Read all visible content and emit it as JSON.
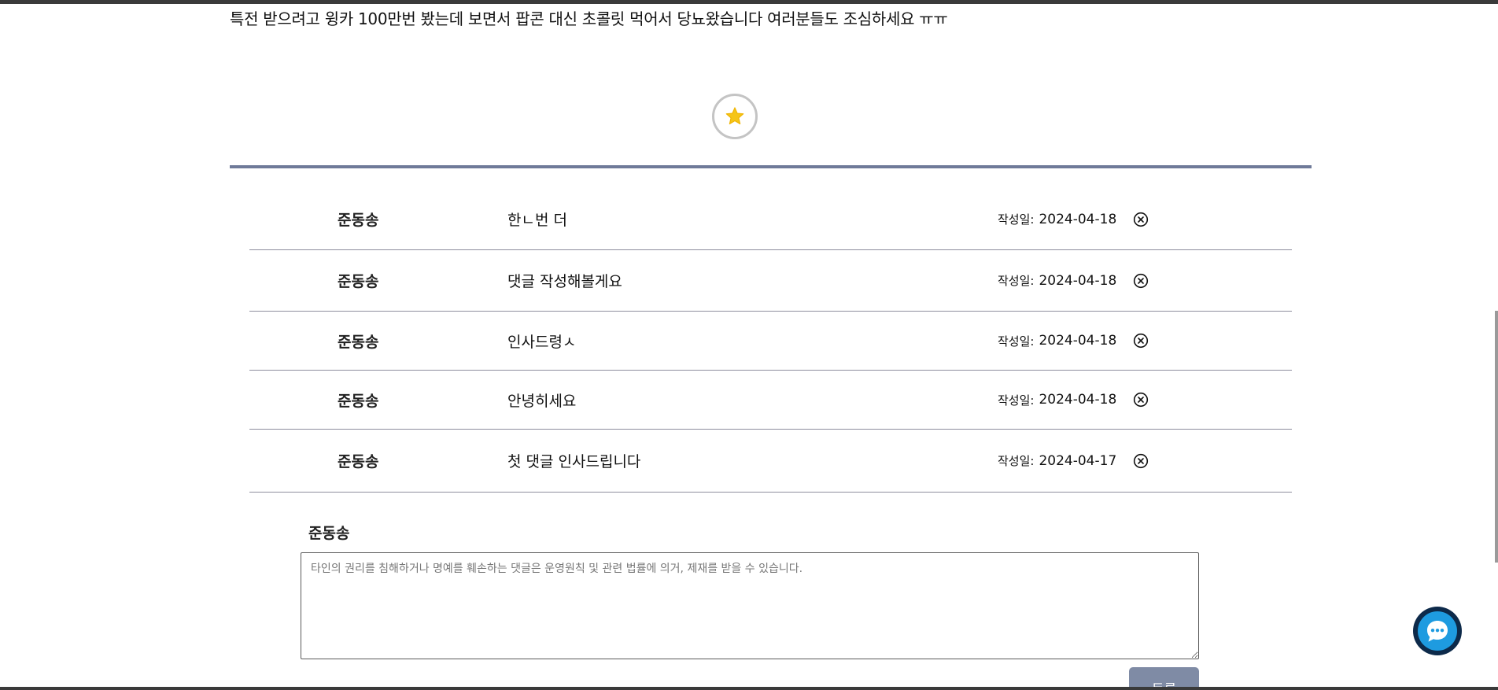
{
  "post": {
    "body": "특전 받으려고 윙카 100만번 봤는데 보면서 팝콘 대신 초콜릿 먹어서 당뇨왔습니다 여러분들도 조심하세요 ㅠㅠ"
  },
  "like": {
    "icon": "star-icon",
    "color": "#f5c518"
  },
  "comments": [
    {
      "author": "준동송",
      "text": "한ㄴ번 더",
      "date_label": "작성일:",
      "date": "2024-04-18"
    },
    {
      "author": "준동송",
      "text": "댓글 작성해볼게요",
      "date_label": "작성일:",
      "date": "2024-04-18"
    },
    {
      "author": "준동송",
      "text": "인사드령ㅅ",
      "date_label": "작성일:",
      "date": "2024-04-18"
    },
    {
      "author": "준동송",
      "text": "안녕히세요",
      "date_label": "작성일:",
      "date": "2024-04-18"
    },
    {
      "author": "준동송",
      "text": "첫 댓글 인사드립니다",
      "date_label": "작성일:",
      "date": "2024-04-17"
    }
  ],
  "comment_form": {
    "writer": "준동송",
    "placeholder": "타인의 권리를 침해하거나 명예를 훼손하는 댓글은 운영원칙 및 관련 법률에 의거, 제재를 받을 수 있습니다.",
    "submit_label": "등록"
  },
  "chat": {
    "icon": "chat-bubble-icon",
    "color": "#1e9be0"
  }
}
